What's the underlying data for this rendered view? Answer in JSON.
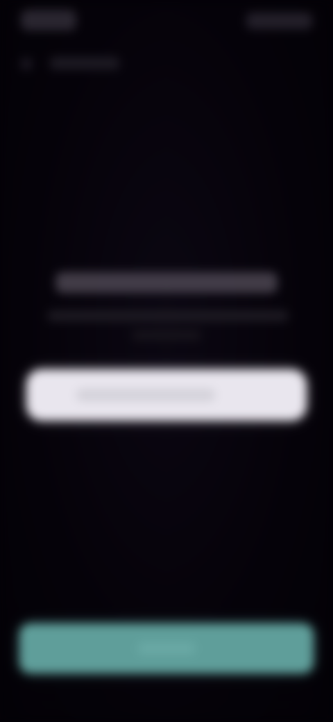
{
  "theme": {
    "background": "#040107",
    "card": "#e9e6ee",
    "primary_button": "#5f9e9a"
  },
  "status_bar": {
    "time": "",
    "icons": [
      "signal-icon",
      "wifi-icon",
      "battery-icon"
    ]
  },
  "nav": {
    "back_icon": "chevron-left-icon",
    "title": ""
  },
  "content": {
    "title": "",
    "subtitle": "",
    "action_card_label": ""
  },
  "footer": {
    "primary_button_label": ""
  }
}
